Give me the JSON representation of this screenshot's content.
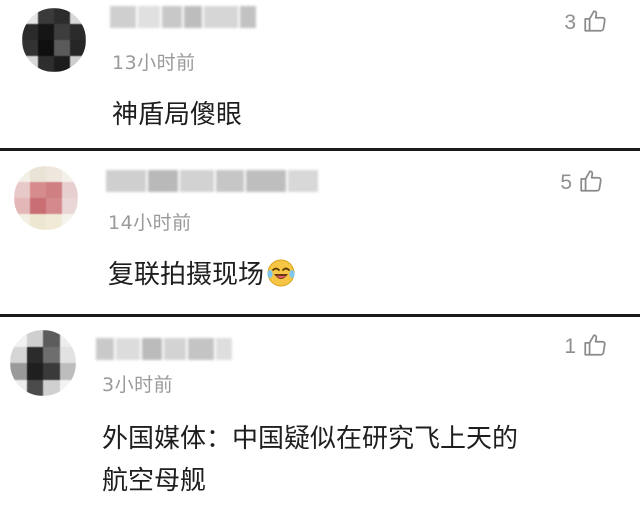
{
  "comments": [
    {
      "time": "13小时前",
      "text": "神盾局傻眼",
      "likes": "3"
    },
    {
      "time": "14小时前",
      "text": "复联拍摄现场",
      "emoji": "laughing-crying-emoji",
      "likes": "5"
    },
    {
      "time": "3小时前",
      "text_line1": "外国媒体：中国疑似在研究飞上天的",
      "text_line2": "航空母舰",
      "likes": "1"
    }
  ],
  "icons": {
    "like": "thumbs-up-icon"
  },
  "colors": {
    "divider": "#1a1a1a",
    "meta": "#9a9a9a",
    "text": "#1e1e1e"
  }
}
